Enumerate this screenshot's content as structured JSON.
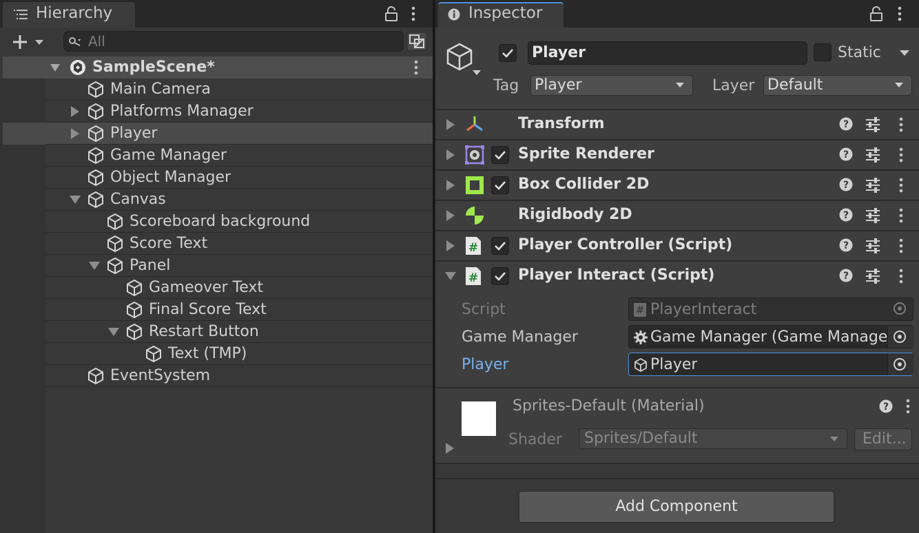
{
  "hierarchy": {
    "tab_label": "Hierarchy",
    "search_placeholder": "All",
    "scene_name": "SampleScene*",
    "items": [
      {
        "label": "Main Camera"
      },
      {
        "label": "Platforms Manager"
      },
      {
        "label": "Player"
      },
      {
        "label": "Game Manager"
      },
      {
        "label": "Object Manager"
      },
      {
        "label": "Canvas"
      },
      {
        "label": "Scoreboard background"
      },
      {
        "label": "Score Text"
      },
      {
        "label": "Panel"
      },
      {
        "label": "Gameover Text"
      },
      {
        "label": "Final Score Text"
      },
      {
        "label": "Restart Button"
      },
      {
        "label": "Text (TMP)"
      },
      {
        "label": "EventSystem"
      }
    ]
  },
  "inspector": {
    "tab_label": "Inspector",
    "object_name": "Player",
    "static_label": "Static",
    "tag_label": "Tag",
    "tag_value": "Player",
    "layer_label": "Layer",
    "layer_value": "Default",
    "components": [
      {
        "title": "Transform"
      },
      {
        "title": "Sprite Renderer"
      },
      {
        "title": "Box Collider 2D"
      },
      {
        "title": "Rigidbody 2D"
      },
      {
        "title": "Player Controller (Script)"
      },
      {
        "title": "Player Interact (Script)"
      }
    ],
    "script_fields": {
      "script_label": "Script",
      "script_value": "PlayerInteract",
      "game_manager_label": "Game Manager",
      "game_manager_value": "Game Manager (Game Manager)",
      "player_label": "Player",
      "player_value": "Player"
    },
    "material": {
      "title": "Sprites-Default (Material)",
      "shader_label": "Shader",
      "shader_value": "Sprites/Default",
      "edit_label": "Edit..."
    },
    "add_component_label": "Add Component"
  },
  "colors": {
    "panel_bg": "#383838",
    "selection": "#4a4a4a",
    "accent_blue": "#4d90e0",
    "icon_green": "#9fe84c"
  },
  "icons": [
    "list-icon",
    "lock-icon",
    "kebab-menu-icon",
    "plus-icon",
    "search-icon",
    "unity-scene-icon",
    "cube-icon",
    "info-icon",
    "gameobject-cube-icon",
    "transform-gizmo-icon",
    "sprite-renderer-icon",
    "box-collider-icon",
    "rigidbody-icon",
    "script-hash-icon",
    "help-icon",
    "preset-sliders-icon",
    "object-picker-icon",
    "gear-icon"
  ]
}
